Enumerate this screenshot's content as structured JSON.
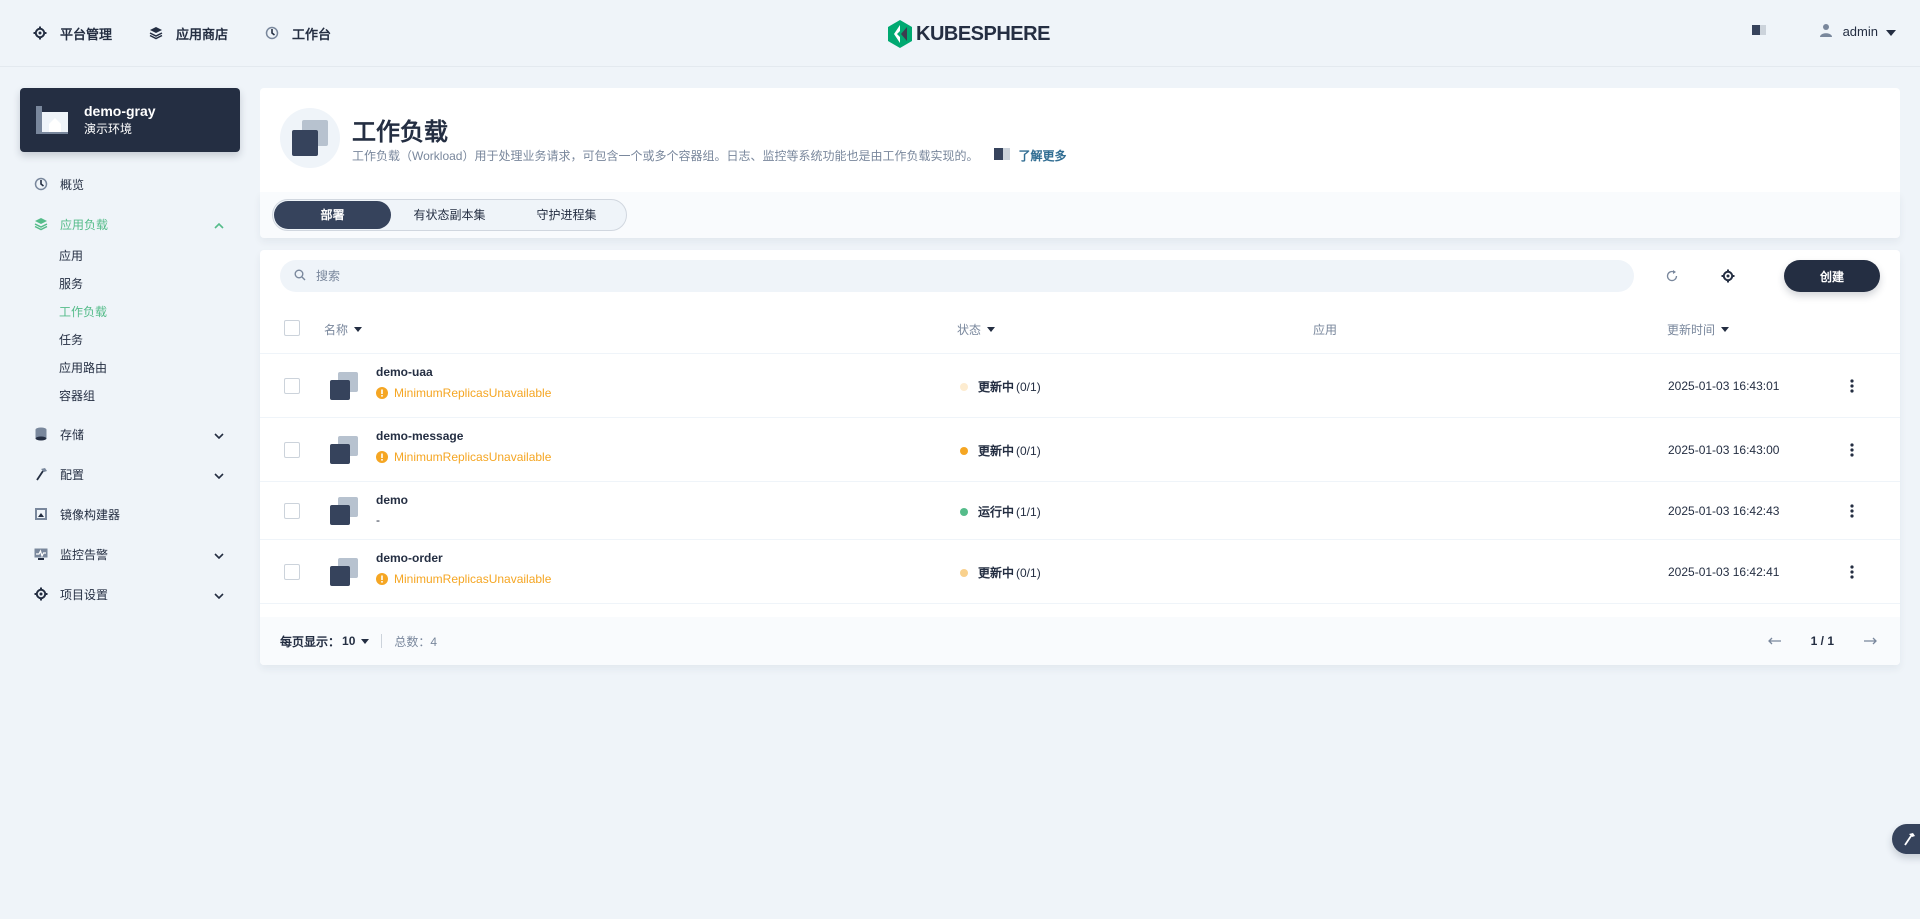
{
  "topnav": {
    "items": [
      {
        "label": "平台管理",
        "icon": "gear-icon"
      },
      {
        "label": "应用商店",
        "icon": "layers-icon"
      },
      {
        "label": "工作台",
        "icon": "dashboard-icon"
      }
    ],
    "logo_text": "KUBESPHERE",
    "user": {
      "name": "admin"
    }
  },
  "workspace": {
    "name": "demo-gray",
    "subtitle": "演示环境"
  },
  "sidebar": {
    "items": [
      {
        "label": "概览"
      },
      {
        "label": "应用负载",
        "expanded": true,
        "active": true,
        "children": [
          "应用",
          "服务",
          "工作负载",
          "任务",
          "应用路由",
          "容器组"
        ],
        "active_child": "工作负载"
      },
      {
        "label": "存储"
      },
      {
        "label": "配置"
      },
      {
        "label": "镜像构建器"
      },
      {
        "label": "监控告警"
      },
      {
        "label": "项目设置"
      }
    ]
  },
  "header": {
    "title": "工作负载",
    "description": "工作负载（Workload）用于处理业务请求，可包含一个或多个容器组。日志、监控等系统功能也是由工作负载实现的。",
    "learn_more": "了解更多"
  },
  "tabs": [
    {
      "label": "部署",
      "active": true
    },
    {
      "label": "有状态副本集"
    },
    {
      "label": "守护进程集"
    }
  ],
  "toolbar": {
    "search_placeholder": "搜索",
    "create_label": "创建"
  },
  "table": {
    "columns": {
      "name": "名称",
      "status": "状态",
      "app": "应用",
      "updated": "更新时间"
    },
    "rows": [
      {
        "name": "demo-uaa",
        "sub": "MinimumReplicasUnavailable",
        "warning": true,
        "status": "更新中",
        "count": "(0/1)",
        "dot_color": "#fdecd0",
        "app": "",
        "updated": "2025-01-03 16:43:01"
      },
      {
        "name": "demo-message",
        "sub": "MinimumReplicasUnavailable",
        "warning": true,
        "status": "更新中",
        "count": "(0/1)",
        "dot_color": "#f5a623",
        "app": "",
        "updated": "2025-01-03 16:43:00"
      },
      {
        "name": "demo",
        "sub": "-",
        "warning": false,
        "status": "运行中",
        "count": "(1/1)",
        "dot_color": "#55bc8a",
        "app": "",
        "updated": "2025-01-03 16:42:43"
      },
      {
        "name": "demo-order",
        "sub": "MinimumReplicasUnavailable",
        "warning": true,
        "status": "更新中",
        "count": "(0/1)",
        "dot_color": "#f9d18d",
        "app": "",
        "updated": "2025-01-03 16:42:41"
      }
    ]
  },
  "footer": {
    "page_size_label": "每页显示：",
    "page_size": "10",
    "total_label": "总数：4",
    "page": "1 / 1"
  },
  "colors": {
    "accent": "#55bc8a",
    "dark": "#242e42",
    "warning": "#f5a623",
    "link": "#326e93"
  }
}
